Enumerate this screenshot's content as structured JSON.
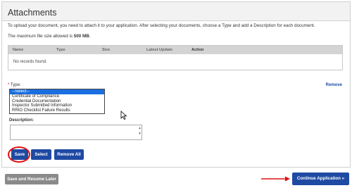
{
  "panel": {
    "title": "Attachments",
    "intro": "To upload your document, you need to attach it to your application. After selecting your documents, choose a Type and add a Description for each document.",
    "max_size_prefix": "The maximum file size allowed is",
    "max_size_value": "500 MB",
    "max_size_suffix": "."
  },
  "grid": {
    "columns": [
      "Name",
      "Type",
      "Size",
      "Latest Update",
      "Action"
    ],
    "empty_text": "No records found."
  },
  "type_field": {
    "required_mark": "*",
    "label": "Type:",
    "remove_label": "Remove",
    "options": [
      "--Select--",
      "Certificate of Compliance",
      "Credential Documentation",
      "Inspector Submitted Information",
      "RRIO Checklist Failure Results"
    ],
    "selected_index": 0
  },
  "description": {
    "label": "Description:",
    "value": ""
  },
  "buttons": {
    "save": "Save",
    "select": "Select",
    "remove_all": "Remove All",
    "save_resume": "Save and Resume Later",
    "continue": "Continue Application »"
  },
  "colors": {
    "primary_button": "#1f4aa3",
    "secondary_button": "#8a8a8a",
    "highlight": "#e01010",
    "selected_option": "#1a6fe0",
    "link": "#1c4aa8"
  }
}
